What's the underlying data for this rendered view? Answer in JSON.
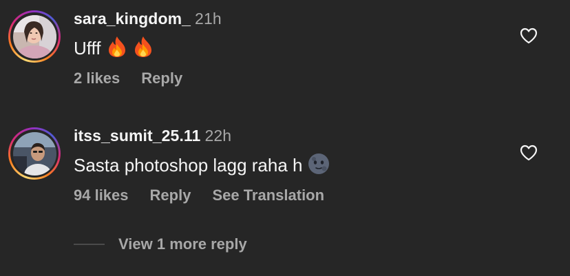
{
  "comments": [
    {
      "username": "sara_kingdom_",
      "time": "21h",
      "text": "Ufff",
      "emojis": [
        "fire-emoji",
        "fire-emoji"
      ],
      "likes": "2 likes",
      "reply": "Reply"
    },
    {
      "username": "itss_sumit_25.11",
      "time": "22h",
      "text": "Sasta photoshop lagg raha h",
      "emojis": [
        "new-moon-face-emoji"
      ],
      "likes": "94 likes",
      "reply": "Reply",
      "translation": "See Translation"
    }
  ],
  "replies": {
    "view_more": "View 1 more reply"
  },
  "colors": {
    "background": "#262626",
    "primary_text": "#f5f5f5",
    "secondary_text": "#a8a8a8"
  }
}
